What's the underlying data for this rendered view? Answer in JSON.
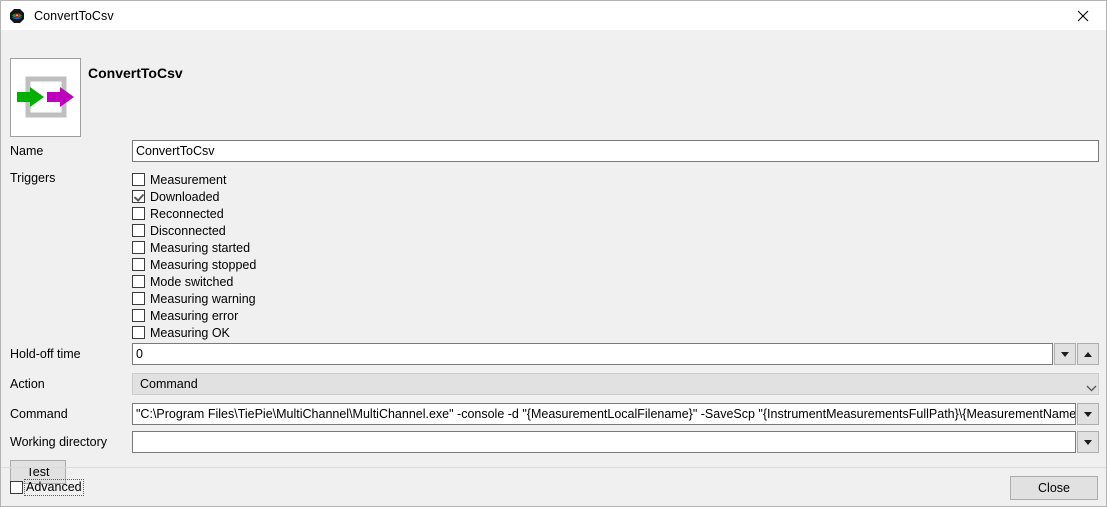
{
  "window": {
    "title": "ConvertToCsv",
    "icon": "app-logo-icon",
    "close_icon": "close-icon"
  },
  "header": {
    "heading": "ConvertToCsv",
    "icon_name": "convert-arrows-icon"
  },
  "form": {
    "name": {
      "label": "Name",
      "value": "ConvertToCsv"
    },
    "triggers": {
      "label": "Triggers",
      "items": [
        {
          "label": "Measurement",
          "checked": false
        },
        {
          "label": "Downloaded",
          "checked": true
        },
        {
          "label": "Reconnected",
          "checked": false
        },
        {
          "label": "Disconnected",
          "checked": false
        },
        {
          "label": "Measuring started",
          "checked": false
        },
        {
          "label": "Measuring stopped",
          "checked": false
        },
        {
          "label": "Mode switched",
          "checked": false
        },
        {
          "label": "Measuring warning",
          "checked": false
        },
        {
          "label": "Measuring error",
          "checked": false
        },
        {
          "label": "Measuring OK",
          "checked": false
        }
      ]
    },
    "holdoff": {
      "label": "Hold-off time",
      "value": "0",
      "spin_down_icon": "triangle-down-icon",
      "spin_up_icon": "triangle-up-icon"
    },
    "action": {
      "label": "Action",
      "value": "Command",
      "chevron_icon": "chevron-down-icon"
    },
    "command": {
      "label": "Command",
      "value": "\"C:\\Program Files\\TiePie\\MultiChannel\\MultiChannel.exe\" -console -d \"{MeasurementLocalFilename}\" -SaveScp \"{InstrumentMeasurementsFullPath}\\{MeasurementName}.csv\"",
      "drop_icon": "triangle-down-icon"
    },
    "working_directory": {
      "label": "Working directory",
      "value": "",
      "drop_icon": "triangle-down-icon"
    }
  },
  "buttons": {
    "test": "Test",
    "close": "Close"
  },
  "advanced": {
    "label": "Advanced",
    "checked": false
  }
}
